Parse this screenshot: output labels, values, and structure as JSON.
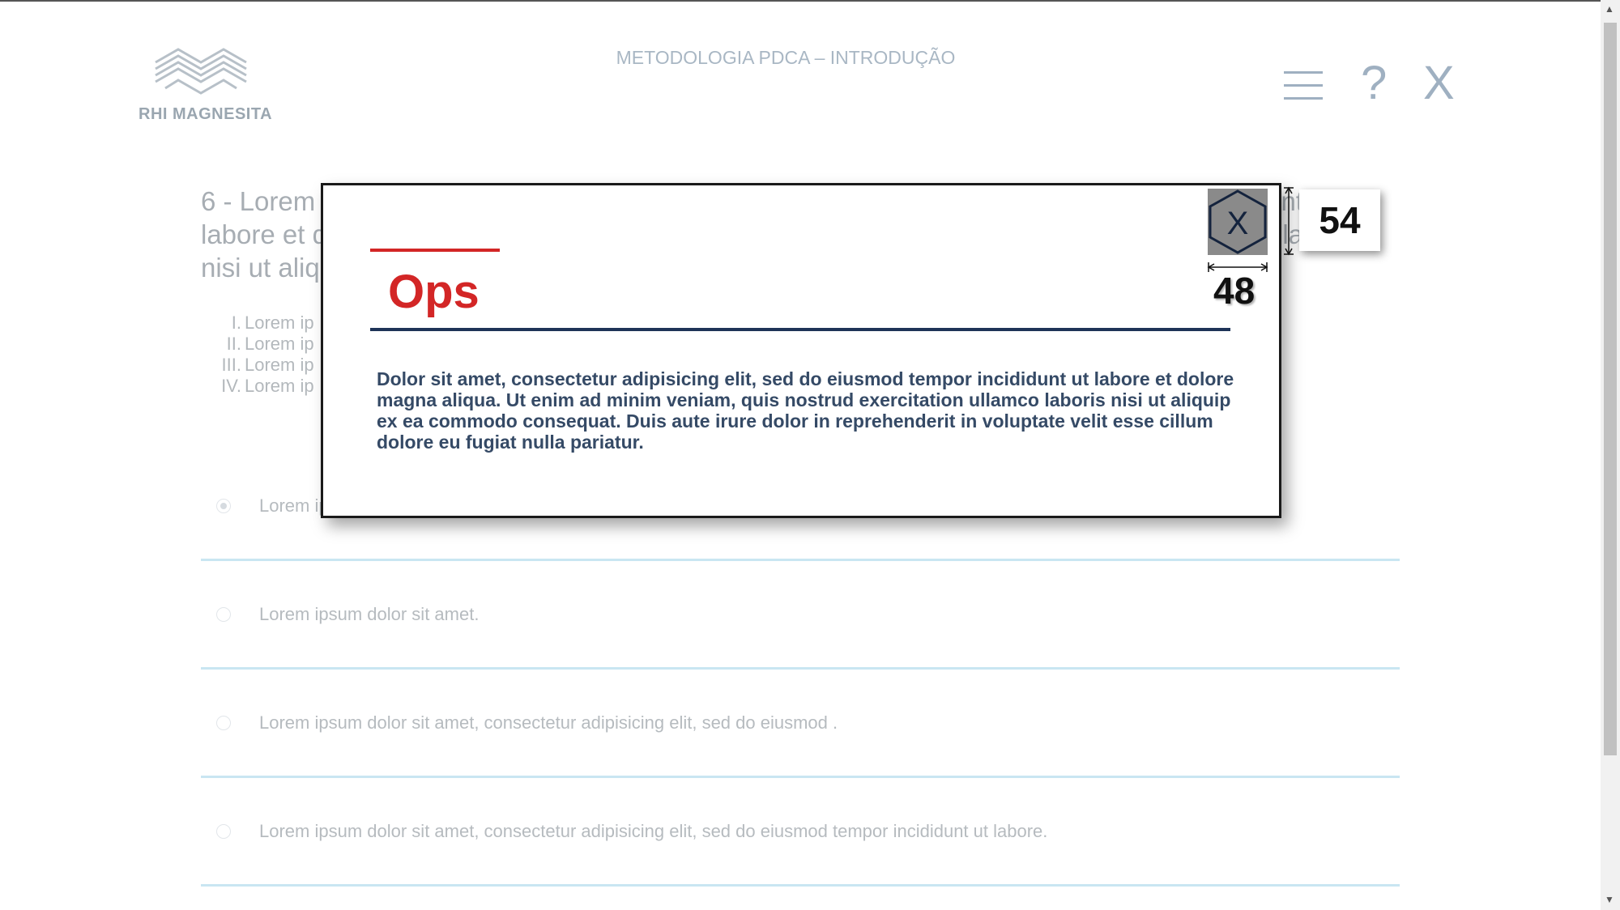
{
  "header": {
    "logo_text": "RHI MAGNESITA",
    "course_title": "METODOLOGIA PDCA – INTRODUÇÃO",
    "help_label": "?",
    "close_label": "X"
  },
  "question": {
    "text": "6 - Lorem ipsum dolor sit amet, consectetur adipisicing elit, sed do eiusmod tempor incididunt ut labore et dolore magna aliqua. Ut enim ad minim veniam, quis nostrud exercitation ullamco laboris nisi ut aliquip.",
    "items": [
      {
        "num": "I.",
        "text": "Lorem ip"
      },
      {
        "num": "II.",
        "text": "Lorem ip"
      },
      {
        "num": "III.",
        "text": "Lorem ip"
      },
      {
        "num": "IV.",
        "text": "Lorem ip"
      }
    ]
  },
  "answers": [
    {
      "text": "Lorem ipsum dolor sit amet, consectetur.",
      "selected": true
    },
    {
      "text": "Lorem ipsum dolor sit amet.",
      "selected": false
    },
    {
      "text": "Lorem ipsum dolor sit amet, consectetur adipisicing elit, sed do eiusmod .",
      "selected": false
    },
    {
      "text": "Lorem ipsum dolor sit amet, consectetur adipisicing elit, sed do eiusmod tempor incididunt ut labore.",
      "selected": false
    }
  ],
  "modal": {
    "title": "Ops",
    "body": "Dolor sit amet, consectetur adipisicing elit, sed do eiusmod tempor incididunt ut labore et dolore magna aliqua. Ut enim ad minim veniam, quis nostrud exercitation ullamco laboris nisi ut aliquip ex ea commodo consequat. Duis aute irure dolor in reprehenderit in voluptate velit esse cillum dolore eu fugiat nulla pariatur.",
    "close_label": "X"
  },
  "annotations": {
    "width_label": "48",
    "height_label": "54"
  },
  "colors": {
    "accent_red": "#d32626",
    "navy": "#1e3358",
    "answer_divider": "#c9e6f2"
  },
  "icons": {
    "logo": "rhi-logo-icon",
    "menu": "hamburger-icon",
    "modal_close": "hexagon-close-icon"
  }
}
